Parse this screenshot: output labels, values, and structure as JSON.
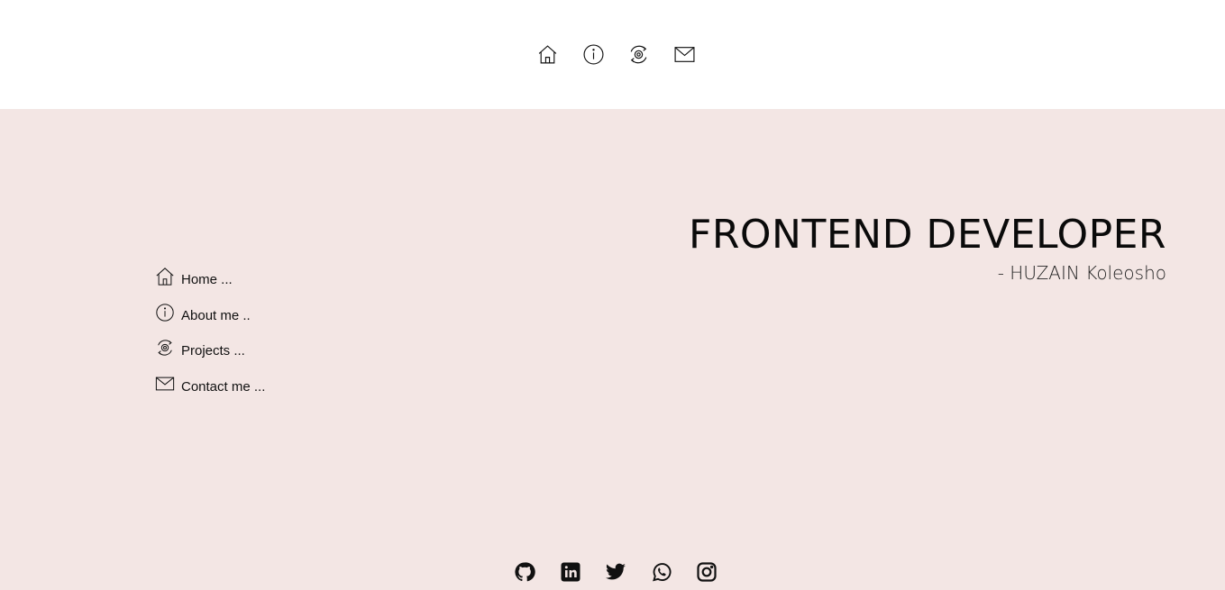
{
  "top_nav": {
    "icons": [
      "home-icon",
      "info-icon",
      "gear-icon",
      "mail-icon"
    ]
  },
  "side_nav": {
    "items": [
      {
        "label": "Home ...",
        "icon": "home-icon"
      },
      {
        "label": "About me ..",
        "icon": "info-icon"
      },
      {
        "label": "Projects ...",
        "icon": "gear-icon"
      },
      {
        "label": "Contact me ...",
        "icon": "mail-icon"
      }
    ]
  },
  "hero": {
    "title": "FRONTEND DEVELOPER",
    "subtitle": "- HUZAIN Koleosho"
  },
  "social": {
    "icons": [
      "github-icon",
      "linkedin-icon",
      "twitter-icon",
      "whatsapp-icon",
      "instagram-icon"
    ]
  },
  "colors": {
    "hero_background": "#f3e6e4",
    "topbar_background": "#ffffff",
    "text": "#111111"
  }
}
